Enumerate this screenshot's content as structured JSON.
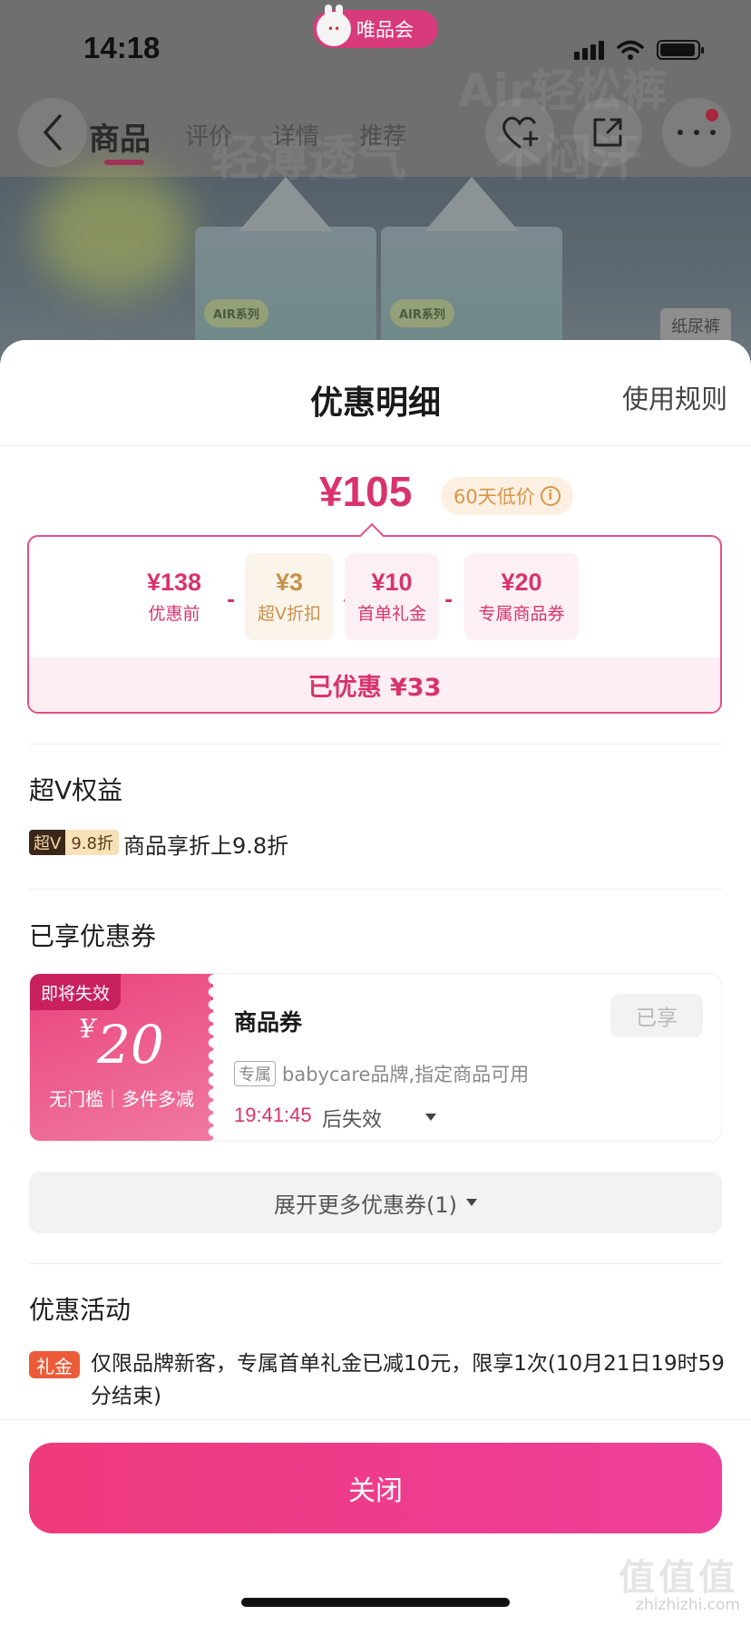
{
  "status_bar": {
    "time": "14:18",
    "app_name": "唯品会"
  },
  "product_nav": {
    "tabs": [
      "商品",
      "评价",
      "详情",
      "推荐"
    ],
    "background_texts": [
      "Air轻松裤",
      "轻薄透气",
      "不闷汗"
    ],
    "bag_tag": "AIR系列",
    "category_chip": "纸尿裤"
  },
  "sheet": {
    "title": "优惠明细",
    "rules_link": "使用规则",
    "final_price": "¥105",
    "low_price_badge": "60天低价",
    "breakdown": [
      {
        "amount": "¥138",
        "label": "优惠前"
      },
      {
        "amount": "¥3",
        "label": "超V折扣"
      },
      {
        "amount": "¥10",
        "label": "首单礼金"
      },
      {
        "amount": "¥20",
        "label": "专属商品券"
      }
    ],
    "minus_sign": "-",
    "saved_text": "已优惠 ¥33",
    "super_v": {
      "heading": "超V权益",
      "badge_left": "超V",
      "badge_right": "9.8折",
      "text": "商品享折上9.8折"
    },
    "coupons": {
      "heading": "已享优惠券",
      "item": {
        "expiring_tag": "即将失效",
        "currency": "¥",
        "amount": "20",
        "condition": "无门槛｜多件多减",
        "name": "商品券",
        "status_button": "已享",
        "exclusive_tag": "专属",
        "scope": "babycare品牌,指定商品可用",
        "countdown": "19:41:45",
        "expire_suffix": "后失效"
      },
      "expand_label": "展开更多优惠券(1)"
    },
    "activities": {
      "heading": "优惠活动",
      "tag": "礼金",
      "text": "仅限品牌新客，专属首单礼金已减10元，限享1次(10月21日19时59分结束)"
    },
    "close_button": "关闭"
  },
  "watermark": {
    "main": "值值值",
    "sub": "zhizhizhi.com"
  },
  "colors": {
    "accent": "#d8336d",
    "gold": "#c8924a",
    "activity_tag": "#ec5b38"
  }
}
